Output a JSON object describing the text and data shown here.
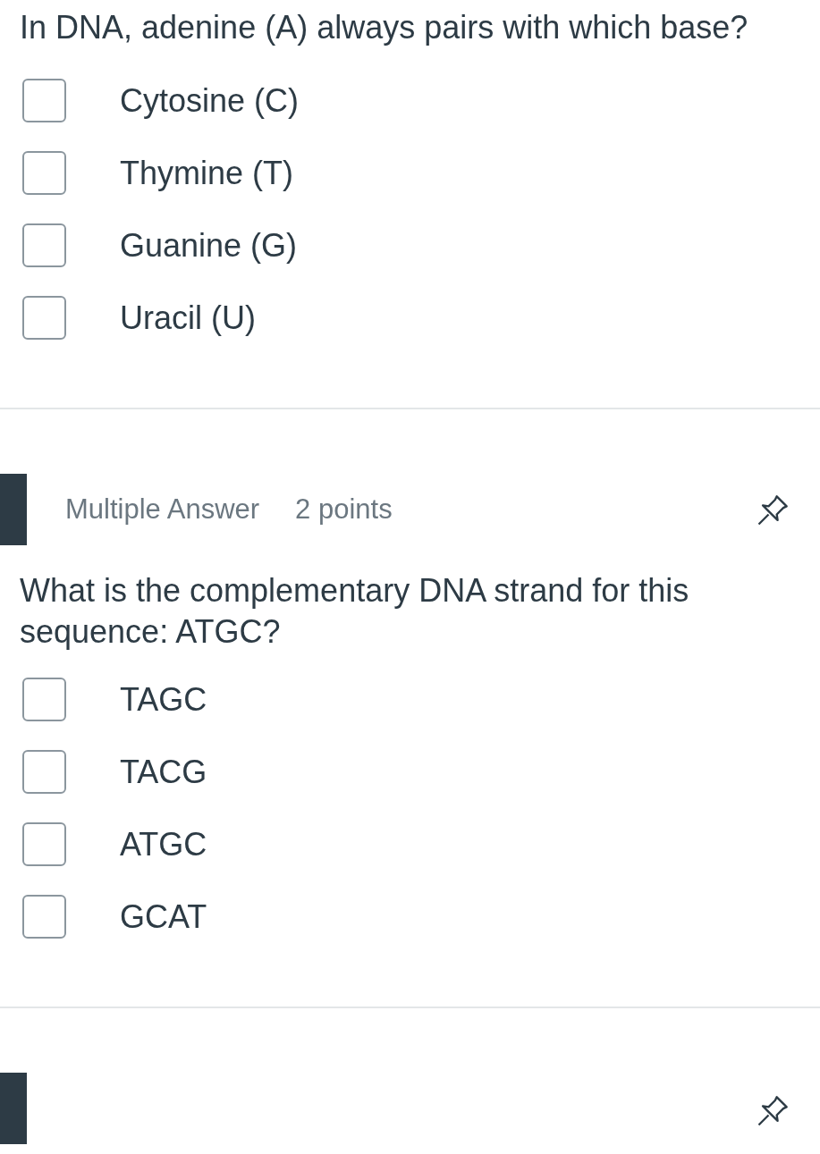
{
  "questions": [
    {
      "kind": "top-cut",
      "prompt": "In DNA, adenine (A) always pairs with which base?",
      "options": [
        {
          "label": "Cytosine (C)",
          "checked": false
        },
        {
          "label": "Thymine (T)",
          "checked": false
        },
        {
          "label": "Guanine (G)",
          "checked": false
        },
        {
          "label": "Uracil (U)",
          "checked": false
        }
      ]
    },
    {
      "kind": "full",
      "type": "Multiple Answer",
      "points": "2 points",
      "prompt": "What is the complementary DNA strand for this sequence: ATGC?",
      "options": [
        {
          "label": "TAGC",
          "checked": false
        },
        {
          "label": "TACG",
          "checked": false
        },
        {
          "label": "ATGC",
          "checked": false
        },
        {
          "label": "GCAT",
          "checked": false
        }
      ]
    },
    {
      "kind": "bottom-cut"
    }
  ]
}
